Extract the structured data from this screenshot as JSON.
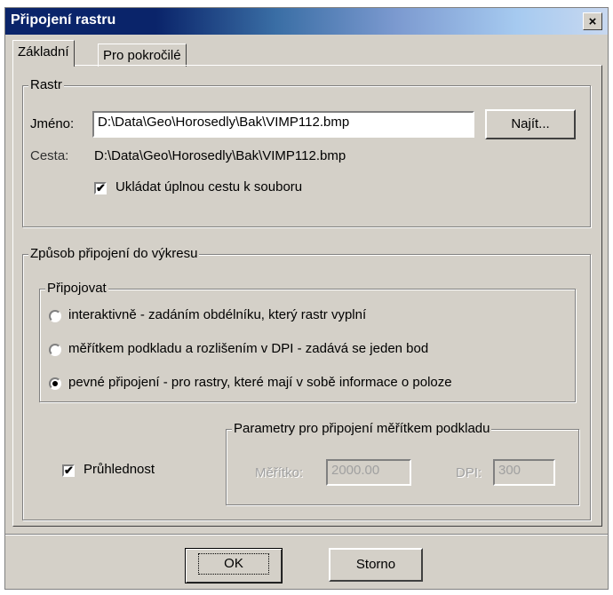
{
  "window": {
    "title": "Připojení rastru",
    "close_label": "×"
  },
  "tabs": [
    {
      "label": "Základní"
    },
    {
      "label": "Pro pokročilé"
    }
  ],
  "raster": {
    "legend": "Rastr",
    "name_label": "Jméno:",
    "name_value": "D:\\Data\\Geo\\Horosedly\\Bak\\VIMP112.bmp",
    "find_button": "Najít...",
    "path_label": "Cesta:",
    "path_value": "D:\\Data\\Geo\\Horosedly\\Bak\\VIMP112.bmp",
    "save_full_path": {
      "label": "Ukládat úplnou cestu k souboru",
      "checked": true
    }
  },
  "attach": {
    "legend": "Způsob připojení do výkresu",
    "connect_legend": "Připojovat",
    "options": [
      {
        "label": "interaktivně - zadáním obdélníku, který rastr vyplní",
        "checked": false
      },
      {
        "label": "měřítkem podkladu a rozlišením v DPI - zadává se jeden bod",
        "checked": false
      },
      {
        "label": "pevné připojení - pro rastry, které mají v sobě informace o poloze",
        "checked": true
      }
    ],
    "transparency": {
      "label": "Průhlednost",
      "checked": true
    },
    "params": {
      "legend": "Parametry pro připojení měřítkem podkladu",
      "scale_label": "Měřítko:",
      "scale_value": "2000.00",
      "dpi_label": "DPI:",
      "dpi_value": "300"
    }
  },
  "buttons": {
    "ok": "OK",
    "cancel": "Storno"
  }
}
